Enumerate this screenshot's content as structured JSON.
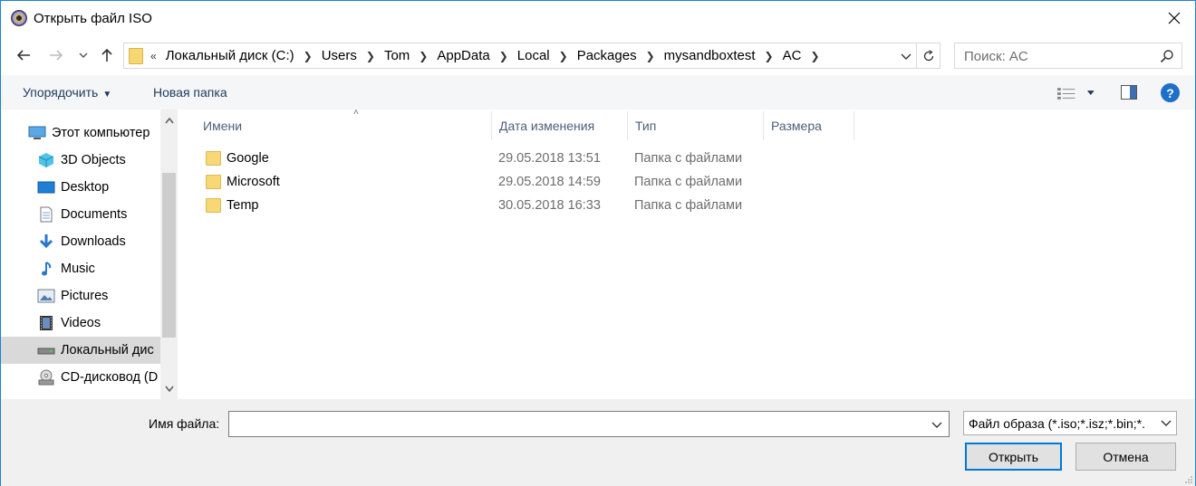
{
  "window": {
    "title": "Открыть файл ISO"
  },
  "nav": {
    "breadcrumb_overflow": "«",
    "breadcrumbs": [
      "Локальный диск (C:)",
      "Users",
      "Tom",
      "AppData",
      "Local",
      "Packages",
      "mysandboxtest",
      "AC"
    ],
    "search_placeholder": "Поиск: AC"
  },
  "toolbar": {
    "organize_label": "Упорядочить",
    "new_folder_label": "Новая папка"
  },
  "sidebar": {
    "items": [
      {
        "label": "Этот компьютер",
        "icon": "computer-icon"
      },
      {
        "label": "3D Objects",
        "icon": "3d-objects-icon"
      },
      {
        "label": "Desktop",
        "icon": "desktop-icon"
      },
      {
        "label": "Documents",
        "icon": "documents-icon"
      },
      {
        "label": "Downloads",
        "icon": "downloads-icon"
      },
      {
        "label": "Music",
        "icon": "music-icon"
      },
      {
        "label": "Pictures",
        "icon": "pictures-icon"
      },
      {
        "label": "Videos",
        "icon": "videos-icon"
      },
      {
        "label": "Локальный дис",
        "icon": "local-disk-icon",
        "selected": true
      },
      {
        "label": "CD-дисковод (D",
        "icon": "cd-drive-icon"
      }
    ]
  },
  "filelist": {
    "columns": [
      "Имени",
      "Дата изменения",
      "Тип",
      "Размера"
    ],
    "rows": [
      {
        "name": "Google",
        "date": "29.05.2018 13:51",
        "type": "Папка с файлами"
      },
      {
        "name": "Microsoft",
        "date": "29.05.2018 14:59",
        "type": "Папка с файлами"
      },
      {
        "name": "Temp",
        "date": "30.05.2018 16:33",
        "type": "Папка с файлами"
      }
    ]
  },
  "bottom": {
    "filename_label": "Имя файла:",
    "filename_value": "",
    "filter_value": "Файл образа (*.iso;*.isz;*.bin;*.",
    "open_label": "Открыть",
    "cancel_label": "Отмена"
  },
  "colors": {
    "accent": "#0078d7",
    "folder": "#f8d775",
    "link_text": "#1e395b",
    "header_text": "#4c607a"
  }
}
